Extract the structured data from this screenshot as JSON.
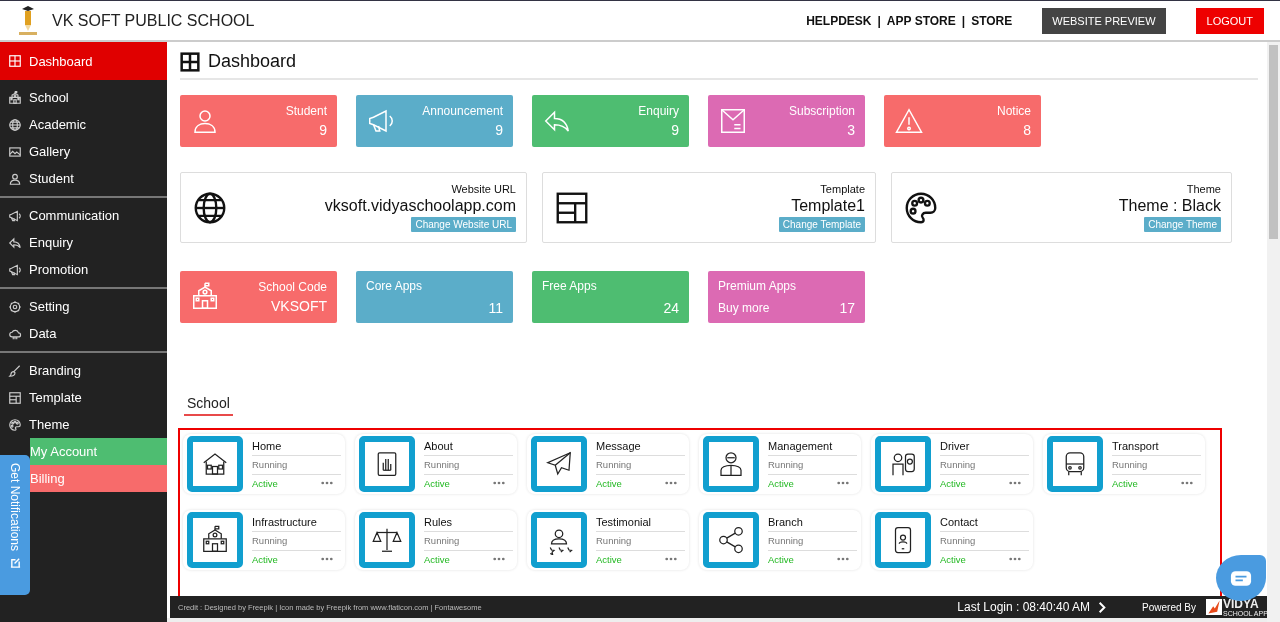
{
  "header": {
    "school_name": "VK SOFT PUBLIC SCHOOL",
    "links": [
      "HELPDESK",
      "APP STORE",
      "STORE"
    ],
    "separator": "|",
    "preview_button": "WEBSITE PREVIEW",
    "logout_button": "LOGOUT"
  },
  "sidebar": {
    "groups": [
      {
        "items": [
          {
            "label": "Dashboard",
            "selected": true
          }
        ]
      },
      {
        "items": [
          {
            "label": "School",
            "selected": false
          },
          {
            "label": "Academic",
            "selected": false
          },
          {
            "label": "Gallery",
            "selected": false
          },
          {
            "label": "Student",
            "selected": false
          }
        ]
      },
      {
        "items": [
          {
            "label": "Communication",
            "selected": false
          },
          {
            "label": "Enquiry",
            "selected": false
          },
          {
            "label": "Promotion",
            "selected": false
          }
        ]
      },
      {
        "items": [
          {
            "label": "Setting",
            "selected": false
          },
          {
            "label": "Data",
            "selected": false
          }
        ]
      },
      {
        "items": [
          {
            "label": "Branding",
            "selected": false
          },
          {
            "label": "Template",
            "selected": false
          },
          {
            "label": "Theme",
            "selected": false
          },
          {
            "label": "My Account",
            "selected": false,
            "color": "#4ebd71"
          },
          {
            "label": "Billing",
            "selected": false,
            "color": "#f76b6b"
          }
        ]
      }
    ]
  },
  "page_title": "Dashboard",
  "stats": [
    {
      "label": "Student",
      "value": "9",
      "color": "#f76b6b"
    },
    {
      "label": "Announcement",
      "value": "9",
      "color": "#5badc9"
    },
    {
      "label": "Enquiry",
      "value": "9",
      "color": "#4ebd71"
    },
    {
      "label": "Subscription",
      "value": "3",
      "color": "#dc6ab3"
    },
    {
      "label": "Notice",
      "value": "8",
      "color": "#f76b6b"
    }
  ],
  "info_cards": [
    {
      "label": "Website URL",
      "value": "vksoft.vidyaschoolapp.com",
      "button": "Change Website URL"
    },
    {
      "label": "Template",
      "value": "Template1",
      "button": "Change Template"
    },
    {
      "label": "Theme",
      "value": "Theme : Black",
      "button": "Change Theme"
    }
  ],
  "app_stats": [
    {
      "kind": "icon",
      "label": "School Code",
      "value": "VKSOFT",
      "color": "#f76b6b"
    },
    {
      "kind": "plain",
      "label": "Core Apps",
      "value": "11",
      "color": "#5badc9"
    },
    {
      "kind": "plain",
      "label": "Free Apps",
      "value": "24",
      "color": "#4ebd71"
    },
    {
      "kind": "plain",
      "label": "Premium Apps",
      "sublabel": "Buy more",
      "value": "17",
      "color": "#dc6ab3"
    }
  ],
  "section": {
    "title": "School",
    "apps": [
      {
        "name": "Home",
        "status": "Running",
        "state": "Active"
      },
      {
        "name": "About",
        "status": "Running",
        "state": "Active"
      },
      {
        "name": "Message",
        "status": "Running",
        "state": "Active"
      },
      {
        "name": "Management",
        "status": "Running",
        "state": "Active"
      },
      {
        "name": "Driver",
        "status": "Running",
        "state": "Active"
      },
      {
        "name": "Transport",
        "status": "Running",
        "state": "Active"
      },
      {
        "name": "Infrastructure",
        "status": "Running",
        "state": "Active"
      },
      {
        "name": "Rules",
        "status": "Running",
        "state": "Active"
      },
      {
        "name": "Testimonial",
        "status": "Running",
        "state": "Active"
      },
      {
        "name": "Branch",
        "status": "Running",
        "state": "Active"
      },
      {
        "name": "Contact",
        "status": "Running",
        "state": "Active"
      }
    ]
  },
  "footer": {
    "credit": "Credit : Designed by Freepik | Icon made by Freepik from www.flaticon.com | Fontawesome",
    "last_login": "Last Login : 08:40:40 AM",
    "powered_by": "Powered By",
    "logo_text": "VIDYA",
    "logo_subtext": "SCHOOL APP"
  },
  "notifications_tab": "Get Notifications"
}
